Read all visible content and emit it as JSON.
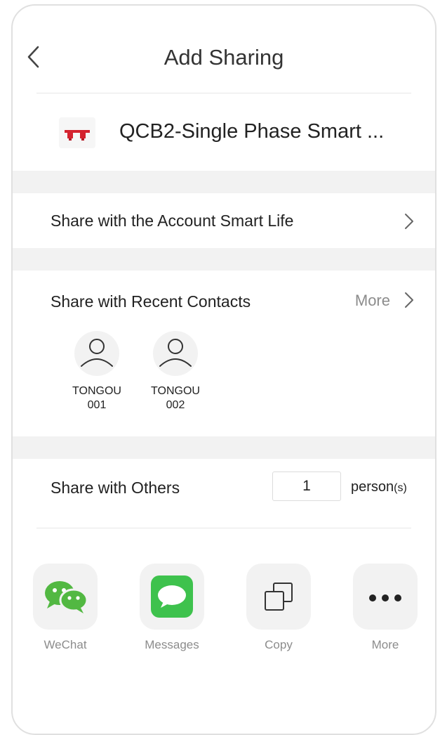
{
  "header": {
    "title": "Add Sharing"
  },
  "device": {
    "name": "QCB2-Single Phase Smart ..."
  },
  "account_share": {
    "label": "Share with the Account Smart Life"
  },
  "recent": {
    "label": "Share with Recent Contacts",
    "more_label": "More",
    "contacts": [
      {
        "name_line1": "TONGOU",
        "name_line2": "001"
      },
      {
        "name_line1": "TONGOU",
        "name_line2": "002"
      }
    ]
  },
  "others": {
    "label": "Share with Others",
    "count": "1",
    "unit_main": "person",
    "unit_suffix": "(s)"
  },
  "share_options": [
    {
      "label": "WeChat",
      "icon": "wechat-icon"
    },
    {
      "label": "Messages",
      "icon": "messages-icon"
    },
    {
      "label": "Copy",
      "icon": "copy-icon"
    },
    {
      "label": "More",
      "icon": "more-dots-icon"
    }
  ],
  "colors": {
    "wechat_green": "#52b842",
    "messages_green": "#3ec24d",
    "device_red": "#d4232f",
    "section_gap": "#f2f2f2",
    "muted_text": "#8c8c8c"
  }
}
